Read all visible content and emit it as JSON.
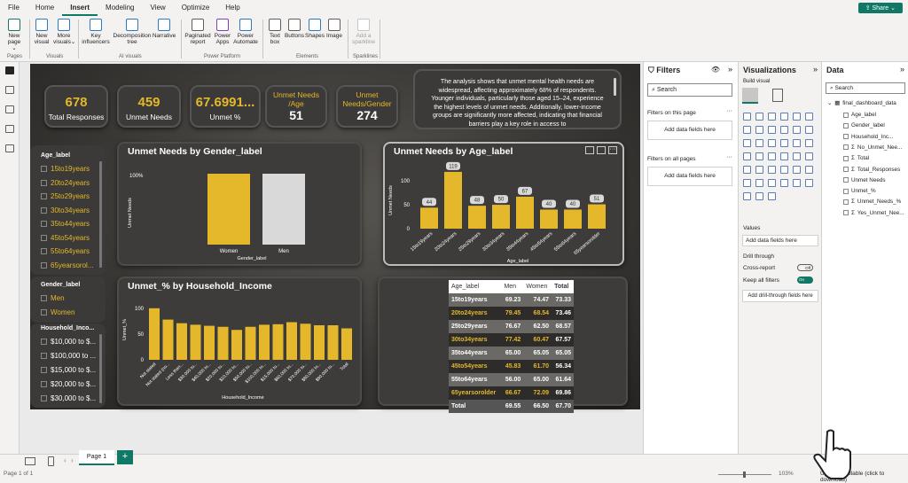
{
  "menu": {
    "tabs": [
      "File",
      "Home",
      "Insert",
      "Modeling",
      "View",
      "Optimize",
      "Help"
    ],
    "active": "Insert",
    "share": "Share"
  },
  "ribbon": {
    "buttons": [
      {
        "label": "New page",
        "sub": "⌄"
      },
      {
        "label": "New visual"
      },
      {
        "label": "More visuals",
        "sub": "⌄"
      },
      {
        "label": "Key influencers"
      },
      {
        "label": "Decomposition tree"
      },
      {
        "label": "Narrative"
      },
      {
        "label": "Paginated report"
      },
      {
        "label": "Power Apps"
      },
      {
        "label": "Power Automate"
      },
      {
        "label": "Text box"
      },
      {
        "label": "Buttons"
      },
      {
        "label": "Shapes"
      },
      {
        "label": "Image"
      },
      {
        "label": "Add a sparkline"
      }
    ],
    "groups": [
      "Pages",
      "Visuals",
      "AI visuals",
      "Power Platform",
      "Elements",
      "Sparklines"
    ]
  },
  "kpis": [
    {
      "value": "678",
      "label": "Total Responses"
    },
    {
      "value": "459",
      "label": "Unmet Needs"
    },
    {
      "value": "67.6991...",
      "label": "Unmet %"
    },
    {
      "label": "Unmet Needs /Age",
      "value": "51"
    },
    {
      "label": "Unmet Needs/Gender",
      "value": "274"
    }
  ],
  "narrative": "The analysis shows that unmet mental health needs are widespread, affecting approximately 68% of respondents. Younger individuals, particularly those aged 15–24, experience the highest levels of unmet needs. Additionally, lower-income groups are significantly more affected, indicating that financial barriers play a key role in access to",
  "slicers": {
    "age": {
      "title": "Age_label",
      "items": [
        "15to19years",
        "20to24years",
        "25to29years",
        "30to34years",
        "35to44years",
        "45to54years",
        "55to64years",
        "65yearsorol..."
      ]
    },
    "gender": {
      "title": "Gender_label",
      "items": [
        "Men",
        "Women"
      ]
    },
    "income": {
      "title": "Household_Inco...",
      "items": [
        "$10,000 to $...",
        "$100,000 to ...",
        "$15,000 to $...",
        "$20,000 to $...",
        "$30,000 to $..."
      ]
    }
  },
  "chart_data": [
    {
      "type": "bar",
      "title": "Unmet Needs by Gender_label",
      "xlabel": "Gender_label",
      "ylabel": "Unmet Needs",
      "categories": [
        "Women",
        "Men"
      ],
      "values": [
        100,
        100
      ],
      "ytick": "100%",
      "colors": [
        "#e5b72b",
        "#d9d9d9"
      ]
    },
    {
      "type": "bar",
      "title": "Unmet Needs by Age_label",
      "xlabel": "Age_label",
      "ylabel": "Unmet Needs",
      "categories": [
        "15to19years",
        "20to24years",
        "25to29years",
        "30to34years",
        "35to44years",
        "45to54years",
        "55to64years",
        "65yearsorolder"
      ],
      "values": [
        44,
        119,
        48,
        50,
        67,
        40,
        40,
        51
      ],
      "yticks": [
        "0",
        "50",
        "100"
      ],
      "ylim": [
        0,
        130
      ]
    },
    {
      "type": "bar",
      "title": "Unmet_% by Household_Income",
      "xlabel": "Household_Income",
      "ylabel": "Unmet_%",
      "categories": [
        "Not stated",
        "Not stated (no...",
        "Less than...",
        "$30,000 to...",
        "$40,000 to...",
        "$20,000 to...",
        "$10,000 to...",
        "$50,000 to...",
        "$100,000 to...",
        "$15,000 to...",
        "$60,000 to...",
        "$70,000 to...",
        "$80,000 to...",
        "$90,000 to...",
        "Total"
      ],
      "values": [
        100,
        78,
        71,
        68,
        66,
        64,
        58,
        64,
        68,
        69,
        73,
        70,
        67,
        67,
        61
      ],
      "yticks": [
        "0",
        "50",
        "100"
      ],
      "ylim": [
        0,
        110
      ]
    }
  ],
  "table": {
    "headers": [
      "Age_label",
      "Men",
      "Women",
      "Total"
    ],
    "rows": [
      [
        "15to19years",
        "69.23",
        "74.47",
        "73.33"
      ],
      [
        "20to24years",
        "79.45",
        "68.54",
        "73.46"
      ],
      [
        "25to29years",
        "76.67",
        "62.50",
        "68.57"
      ],
      [
        "30to34years",
        "77.42",
        "60.47",
        "67.57"
      ],
      [
        "35to44years",
        "65.00",
        "65.05",
        "65.05"
      ],
      [
        "45to54years",
        "45.83",
        "61.70",
        "56.34"
      ],
      [
        "55to64years",
        "56.00",
        "65.00",
        "61.64"
      ],
      [
        "65yearsorolder",
        "66.67",
        "72.09",
        "69.86"
      ]
    ],
    "total": [
      "Total",
      "69.55",
      "66.50",
      "67.70"
    ]
  },
  "filters": {
    "title": "Filters",
    "search": "Search",
    "on_page": "Filters on this page",
    "all_pages": "Filters on all pages",
    "add": "Add data fields here"
  },
  "viz": {
    "title": "Visualizations",
    "build": "Build visual",
    "values": "Values",
    "add_values": "Add data fields here",
    "drill": "Drill through",
    "cross": "Cross-report",
    "cross_state": "Off",
    "keep": "Keep all filters",
    "keep_state": "On",
    "add_drill": "Add drill-through fields here"
  },
  "data": {
    "title": "Data",
    "search": "Search",
    "table": "final_dashboard_data",
    "fields": [
      "Age_label",
      "Gender_label",
      "Household_Inc...",
      "No_Unmet_Nee...",
      "Total",
      "Total_Responses",
      "Unmet Needs",
      "Unmet_%",
      "Unmet_Needs_%",
      "Yes_Unmet_Nee..."
    ],
    "sigma": [
      false,
      false,
      false,
      true,
      true,
      true,
      false,
      false,
      true,
      true
    ]
  },
  "bottom": {
    "page": "Page 1",
    "status": "Page 1 of 1",
    "zoom": "103%",
    "update": "Update available (click to download)"
  }
}
